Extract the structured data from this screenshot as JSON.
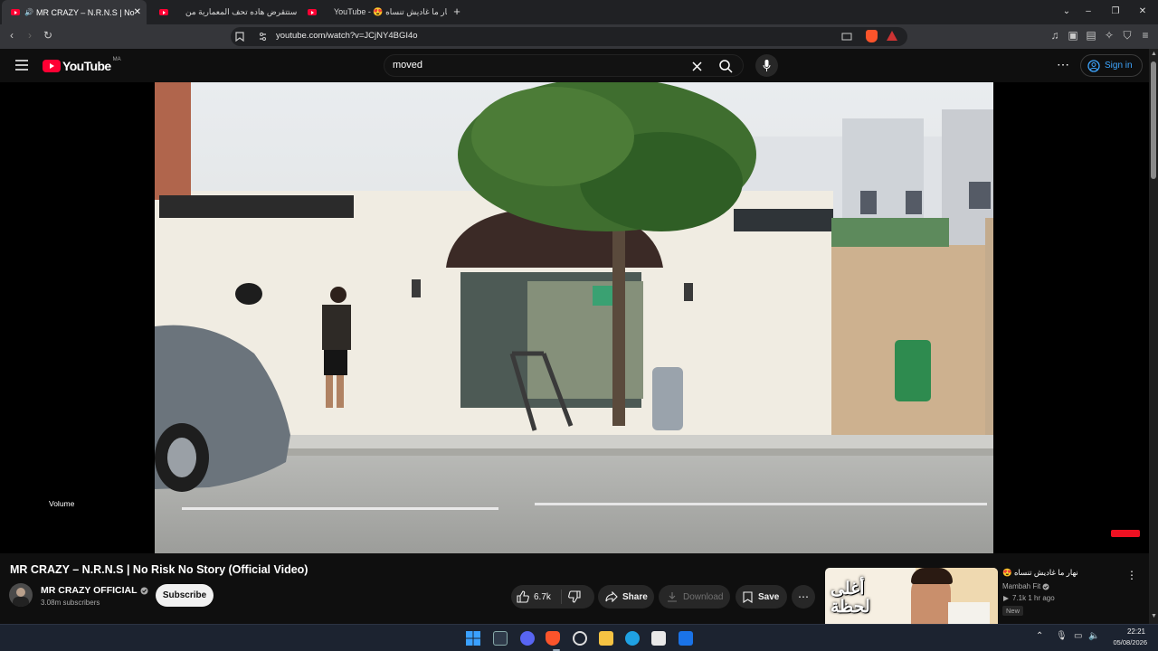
{
  "browser": {
    "tabs": [
      {
        "title": "MR CRAZY – N.R.N.S | No Ris",
        "active": true
      },
      {
        "title": "قريبا ستتقرض هاده تحف المعمارية من",
        "active": false
      },
      {
        "title": "YouTube - 😍 نهار ما غاديش تنساه",
        "active": false
      }
    ],
    "new_tab": "+",
    "url": "youtube.com/watch?v=JCjNY4BGI4o"
  },
  "youtube": {
    "logo_text": "YouTube",
    "region": "MA",
    "search_value": "moved",
    "sign_in": "Sign in"
  },
  "player": {
    "volume_tooltip": "Volume"
  },
  "video": {
    "title": "MR CRAZY – N.R.N.S | No Risk No Story (Official Video)",
    "channel": "MR CRAZY OFFICIAL",
    "subscribers": "3.08m subscribers",
    "subscribe": "Subscribe",
    "likes": "6.7k",
    "share": "Share",
    "download": "Download",
    "save": "Save"
  },
  "recommendation": {
    "title": "😍 نهار ما غاديش تنساه",
    "channel": "Mambah Fit",
    "meta": "7.1k  1 hr ago",
    "badge": "New",
    "thumb_text": "أغلى لحظة"
  },
  "taskbar": {
    "time": "22:21",
    "date": "05/08/2026"
  },
  "colors": {
    "yt_red": "#ff0033",
    "signin_blue": "#3ea6ff",
    "page_bg": "#0f0f0f"
  }
}
